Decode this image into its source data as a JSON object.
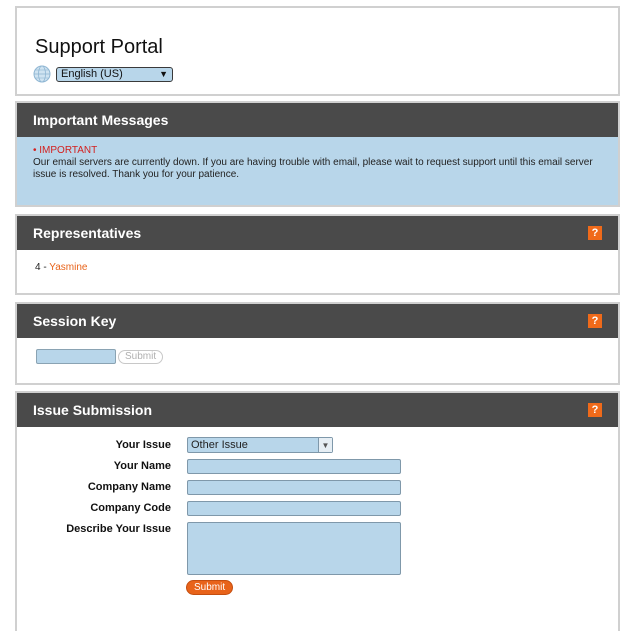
{
  "header": {
    "title": "Support Portal",
    "language": {
      "selected": "English (US)"
    }
  },
  "messages": {
    "heading": "Important Messages",
    "items": [
      {
        "tag": "• IMPORTANT",
        "text": "Our email servers are currently down. If you are having trouble with email, please wait to request support until this email server issue is resolved. Thank you for your patience."
      }
    ]
  },
  "representatives": {
    "heading": "Representatives",
    "help": "?",
    "items": [
      {
        "number": "4",
        "separator": " - ",
        "name": "Yasmine"
      }
    ]
  },
  "session": {
    "heading": "Session Key",
    "help": "?",
    "key_value": "",
    "submit_label": "Submit"
  },
  "issue": {
    "heading": "Issue Submission",
    "help": "?",
    "fields": {
      "issue_label": "Your Issue",
      "issue_value": "Other Issue",
      "name_label": "Your Name",
      "company_label": "Company Name",
      "code_label": "Company Code",
      "describe_label": "Describe Your Issue"
    },
    "submit_label": "Submit"
  },
  "colors": {
    "header_bg": "#4a4a4a",
    "accent": "#e8631a",
    "input_bg": "#b8d6ea",
    "alert": "#d3201f"
  }
}
